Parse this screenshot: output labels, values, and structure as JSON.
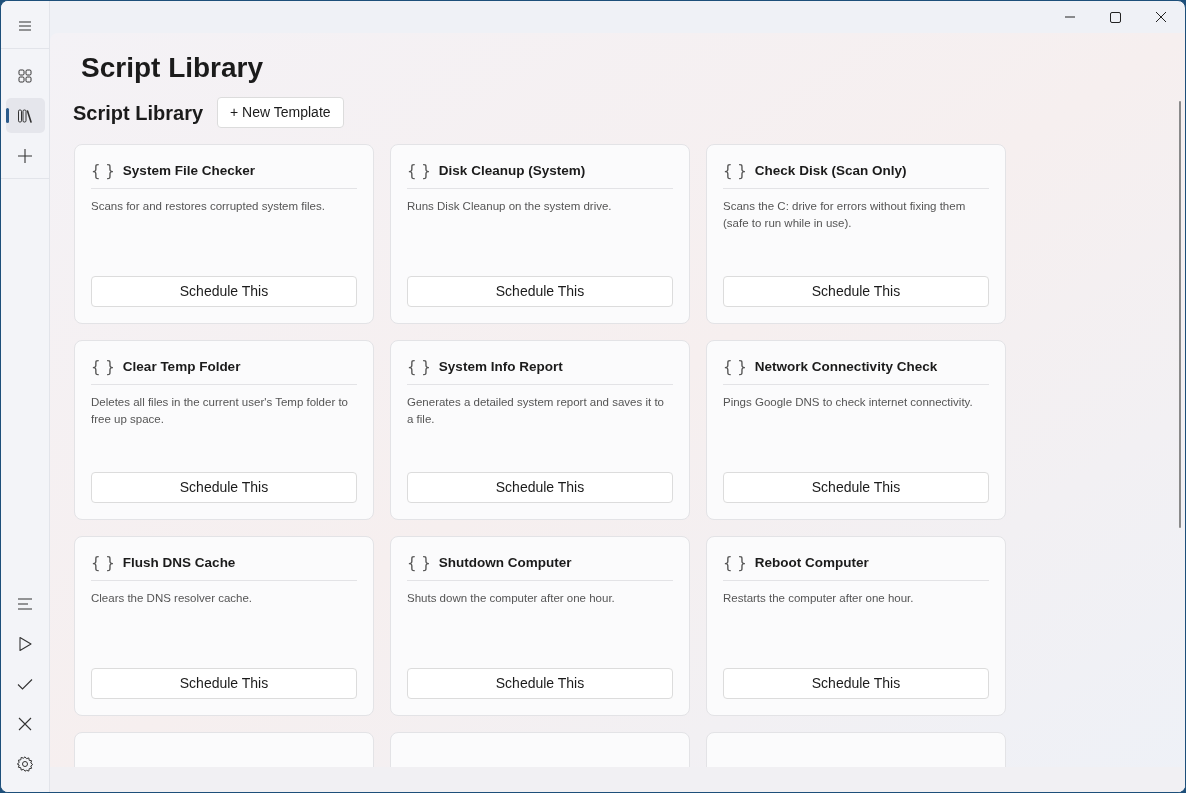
{
  "sidebar": {
    "top_items": [
      {
        "kind": "menu",
        "selected": false
      },
      {
        "kind": "grid",
        "selected": false
      },
      {
        "kind": "library",
        "selected": true
      },
      {
        "kind": "add",
        "selected": false
      }
    ],
    "bottom_items": [
      {
        "kind": "list",
        "selected": false
      },
      {
        "kind": "play",
        "selected": false
      },
      {
        "kind": "check",
        "selected": false
      },
      {
        "kind": "close",
        "selected": false
      },
      {
        "kind": "settings",
        "selected": false
      }
    ]
  },
  "page_title": "Script Library",
  "section": {
    "title": "Script Library",
    "new_button": "+ New Template"
  },
  "cards": [
    {
      "kind": "full",
      "icon": "{ }",
      "title": "System File Checker",
      "description": "Scans for and restores corrupted system files.",
      "button": "Schedule This"
    },
    {
      "kind": "full",
      "icon": "{ }",
      "title": "Disk Cleanup (System)",
      "description": "Runs Disk Cleanup on the system drive.",
      "button": "Schedule This"
    },
    {
      "kind": "full",
      "icon": "{ }",
      "title": "Check Disk (Scan Only)",
      "description": "Scans the C: drive for errors without fixing them (safe to run while in use).",
      "button": "Schedule This"
    },
    {
      "kind": "full",
      "icon": "{ }",
      "title": "Clear Temp Folder",
      "description": "Deletes all files in the current user's Temp folder to free up space.",
      "button": "Schedule This"
    },
    {
      "kind": "full",
      "icon": "{ }",
      "title": "System Info Report",
      "description": "Generates a detailed system report and saves it to a file.",
      "button": "Schedule This"
    },
    {
      "kind": "full",
      "icon": "{ }",
      "title": "Network Connectivity Check",
      "description": "Pings Google DNS to check internet connectivity.",
      "button": "Schedule This"
    },
    {
      "kind": "full",
      "icon": "{ }",
      "title": "Flush DNS Cache",
      "description": "Clears the DNS resolver cache.",
      "button": "Schedule This"
    },
    {
      "kind": "full",
      "icon": "{ }",
      "title": "Shutdown Computer",
      "description": "Shuts down the computer after one hour.",
      "button": "Schedule This"
    },
    {
      "kind": "full",
      "icon": "{ }",
      "title": "Reboot Computer",
      "description": "Restarts the computer after one hour.",
      "button": "Schedule This"
    },
    {
      "kind": "partial"
    },
    {
      "kind": "partial"
    },
    {
      "kind": "partial"
    }
  ]
}
